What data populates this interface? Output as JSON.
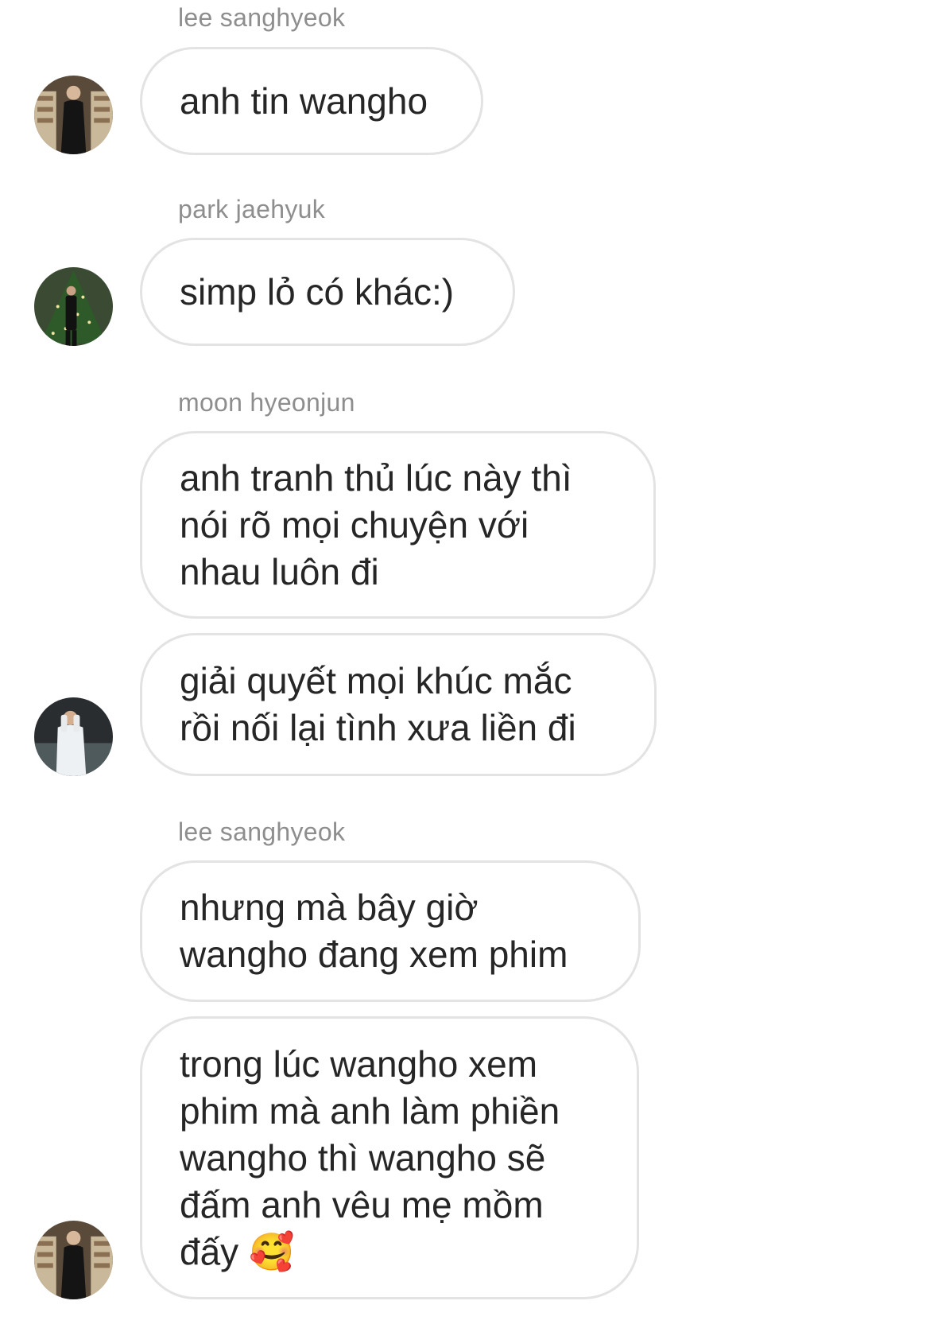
{
  "messages": [
    {
      "sender": "lee sanghyeok",
      "text": "anh tin wangho"
    },
    {
      "sender": "park jaehyuk",
      "text": "simp lỏ có khác:)"
    },
    {
      "sender": "moon hyeonjun",
      "text": "anh tranh thủ lúc này thì\nnói rõ mọi chuyện với\nnhau luôn đi"
    },
    {
      "sender": "moon hyeonjun",
      "text": "giải quyết mọi khúc mắc\nrồi nối lại tình xưa liền đi"
    },
    {
      "sender": "lee sanghyeok",
      "text": "nhưng mà bây giờ\nwangho đang xem phim"
    },
    {
      "sender": "lee sanghyeok",
      "text": "trong lúc wangho xem\nphim mà anh làm phiền\nwangho thì wangho sẽ\nđấm anh vêu mẹ mồm\nđấy 🥰"
    }
  ],
  "avatars": {
    "lee_sanghyeok": "profile-photo-library",
    "park_jaehyuk": "profile-photo-christmas-tree",
    "moon_hyeonjun": "profile-photo-white-shirt"
  },
  "colors": {
    "bubble_border": "#e3e3e3",
    "sender_name": "#8e8e8e",
    "message_text": "#262626"
  }
}
